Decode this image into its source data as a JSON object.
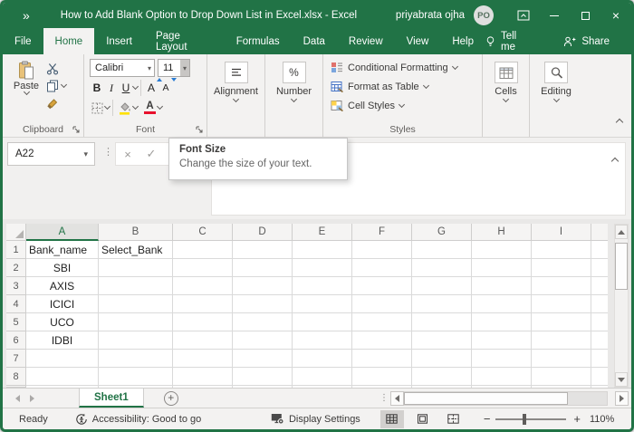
{
  "icons": {
    "qat_chevrons": "»",
    "close": "×",
    "dropdown": "▾",
    "dots_handle": "⋮",
    "cancel": "×",
    "enter": "✓",
    "add_sheet": "+",
    "zoom_out": "−",
    "zoom_in": "+"
  },
  "titlebar": {
    "title": "How to Add Blank Option to Drop Down List in Excel.xlsx  -  Excel",
    "user": "priyabrata ojha",
    "avatar": "PO"
  },
  "tabs": {
    "items": [
      "File",
      "Home",
      "Insert",
      "Page Layout",
      "Formulas",
      "Data",
      "Review",
      "View",
      "Help"
    ],
    "active": "Home",
    "tell_me": "Tell me",
    "share": "Share"
  },
  "ribbon": {
    "clipboard": {
      "label": "Clipboard",
      "paste": "Paste"
    },
    "font": {
      "label": "Font",
      "name": "Calibri",
      "size": "11",
      "bold": "B",
      "italic": "I",
      "underline": "U",
      "grow": "A",
      "shrink": "A",
      "color_letter": "A"
    },
    "alignment": {
      "label": "Alignment"
    },
    "number": {
      "label": "Number",
      "percent": "%"
    },
    "styles": {
      "label": "Styles",
      "conditional_formatting": "Conditional Formatting",
      "format_as_table": "Format as Table",
      "cell_styles": "Cell Styles"
    },
    "cells": {
      "label": "Cells"
    },
    "editing": {
      "label": "Editing"
    }
  },
  "tooltip": {
    "title": "Font Size",
    "body": "Change the size of your text."
  },
  "formula_bar": {
    "name_box": "A22"
  },
  "grid": {
    "column_headers": [
      "A",
      "B",
      "C",
      "D",
      "E",
      "F",
      "G",
      "H",
      "I"
    ],
    "selected_column": "A",
    "rows": [
      {
        "num": "1",
        "A": "Bank_name",
        "B": "Select_Bank"
      },
      {
        "num": "2",
        "A": "SBI",
        "B": ""
      },
      {
        "num": "3",
        "A": "AXIS",
        "B": ""
      },
      {
        "num": "4",
        "A": "ICICI",
        "B": ""
      },
      {
        "num": "5",
        "A": "UCO",
        "B": ""
      },
      {
        "num": "6",
        "A": "IDBI",
        "B": ""
      },
      {
        "num": "7",
        "A": "",
        "B": ""
      },
      {
        "num": "8",
        "A": "",
        "B": ""
      }
    ]
  },
  "sheet_bar": {
    "active_sheet": "Sheet1"
  },
  "status_bar": {
    "mode": "Ready",
    "accessibility": "Accessibility: Good to go",
    "display_settings": "Display Settings",
    "zoom_level": "110%"
  }
}
